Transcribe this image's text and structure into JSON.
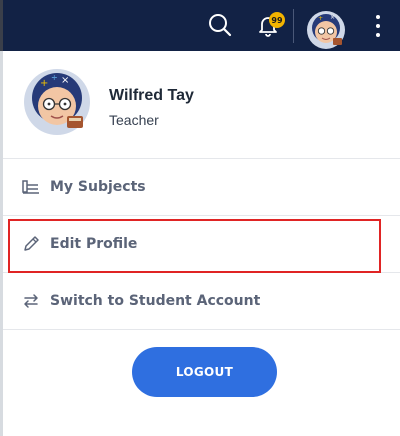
{
  "topbar": {
    "search_icon": "search-icon",
    "bell_icon": "bell-icon",
    "notification_count": "99",
    "menu_icon": "kebab-menu-icon"
  },
  "profile": {
    "name": "Wilfred Tay",
    "role": "Teacher"
  },
  "menu": {
    "items": [
      {
        "label": "My Subjects",
        "icon": "books-icon"
      },
      {
        "label": "Edit Profile",
        "icon": "pencil-icon"
      },
      {
        "label": "Switch to Student Account",
        "icon": "switch-arrows-icon"
      }
    ]
  },
  "logout_label": "LOGOUT",
  "colors": {
    "topbar_bg": "#122245",
    "badge": "#f3b400",
    "logout_button": "#2f6fe0",
    "highlight_border": "#e02424"
  }
}
